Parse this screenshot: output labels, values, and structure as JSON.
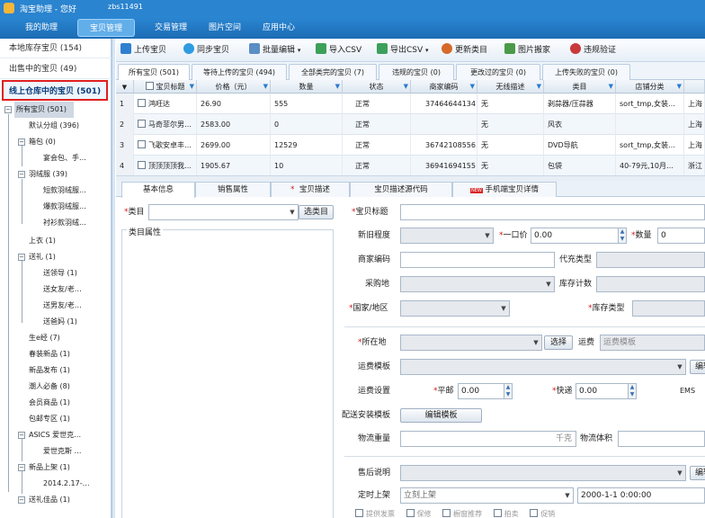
{
  "app": {
    "title": "淘宝助理 - 您好",
    "user": "zbs11491"
  },
  "menu": [
    "我的助理",
    "宝贝管理",
    "交易管理",
    "图片空间",
    "应用中心"
  ],
  "left_nav": {
    "local": "本地库存宝贝 (154)",
    "on_sale": "出售中的宝贝 (49)",
    "warehouse": "线上仓库中的宝贝 (501)"
  },
  "tree": [
    "所有宝贝 (501)",
    "默认分组 (396)",
    "箱包 (0)",
    "宴会包、手…",
    "羽绒服 (39)",
    "短款羽绒服…",
    "爆款羽绒服…",
    "衬衫款羽绒…",
    "上衣 (1)",
    "送礼 (1)",
    "送领导 (1)",
    "送女友/老…",
    "送男友/老…",
    "送爸妈 (1)",
    "生e经 (7)",
    "春装新品 (1)",
    "新品发布 (1)",
    "潮人必备 (8)",
    "会员商品 (1)",
    "包邮专区 (1)",
    "ASICS 爱世克…",
    "爱世克斯 …",
    "新品上架 (1)",
    "2014.2.17-…",
    "送礼佳品 (1)"
  ],
  "toolbar": [
    "上传宝贝",
    "同步宝贝",
    "批量编辑",
    "导入CSV",
    "导出CSV",
    "更新类目",
    "图片搬家",
    "违规验证"
  ],
  "filter_tabs": [
    "所有宝贝 (501)",
    "等待上传的宝贝 (494)",
    "全部类完的宝贝 (7)",
    "违规的宝贝 (0)",
    "更改过的宝贝 (0)",
    "上传失败的宝贝 (0)"
  ],
  "grid": {
    "headers": [
      "宝贝标题",
      "价格（元）",
      "数量",
      "状态",
      "商家编码",
      "无线描述",
      "类目",
      "店铺分类",
      ""
    ],
    "rows": [
      {
        "no": "1",
        "title": "鸿旺达",
        "price": "26.90",
        "qty": "555",
        "status": "正常",
        "code": "37464644134",
        "wireless": "无",
        "cat": "剥蒜器/压蒜器",
        "shopcat": "sort_tmp,女装…",
        "loc": "上海"
      },
      {
        "no": "2",
        "title": "马奇菲尔男…",
        "price": "2583.00",
        "qty": "0",
        "status": "正常",
        "code": "",
        "wireless": "无",
        "cat": "风衣",
        "shopcat": "",
        "loc": "上海"
      },
      {
        "no": "3",
        "title": "飞歌安卓丰…",
        "price": "2699.00",
        "qty": "12529",
        "status": "正常",
        "code": "36742108556",
        "wireless": "无",
        "cat": "DVD导航",
        "shopcat": "sort_tmp,女装…",
        "loc": "上海"
      },
      {
        "no": "4",
        "title": "顶顶顶顶我…",
        "price": "1905.67",
        "qty": "10",
        "status": "正常",
        "code": "36941694155",
        "wireless": "无",
        "cat": "包袋",
        "shopcat": "40-79元,10月…",
        "loc": "浙江"
      }
    ]
  },
  "detail_tabs": [
    "基本信息",
    "销售属性",
    "宝贝描述",
    "宝贝描述源代码",
    "手机端宝贝详情"
  ],
  "new_badge": "NEW",
  "form": {
    "category_label": "类目",
    "category_btn": "选类目",
    "cat_attr": "类目属性",
    "title_label": "宝贝标题",
    "newness": "新旧程度",
    "price_label": "一口价",
    "price_value": "0.00",
    "qty_label": "数量",
    "qty_value": "0",
    "merchant_code": "商家编码",
    "code_type": "代充类型",
    "purchase_place": "采购地",
    "stock_count": "库存计数",
    "country": "国家/地区",
    "stock_type": "库存类型",
    "location": "所在地",
    "choose_btn": "选择",
    "freight": "运费",
    "freight_template_ph": "运费模板",
    "freight_template": "运费模板",
    "edit_btn": "编辑",
    "freight_setting": "运费设置",
    "normal_mail": "平邮",
    "normal_val": "0.00",
    "express": "快递",
    "express_val": "0.00",
    "ems": "EMS",
    "install_template": "配送安装模板",
    "edit_template_btn": "编辑模板",
    "weight": "物流重量",
    "weight_unit": "千克",
    "volume": "物流体积",
    "after_sale": "售后说明",
    "timed": "定时上架",
    "timed_value": "立刻上架",
    "timed_date": "2000-1-1 0:00:00",
    "bottom_checks": [
      "提供发票",
      "保修",
      "橱窗推荐",
      "拍卖",
      "促销"
    ]
  },
  "colors": {
    "menu_blue": "#1c6cb5",
    "active_red": "#e02020"
  }
}
